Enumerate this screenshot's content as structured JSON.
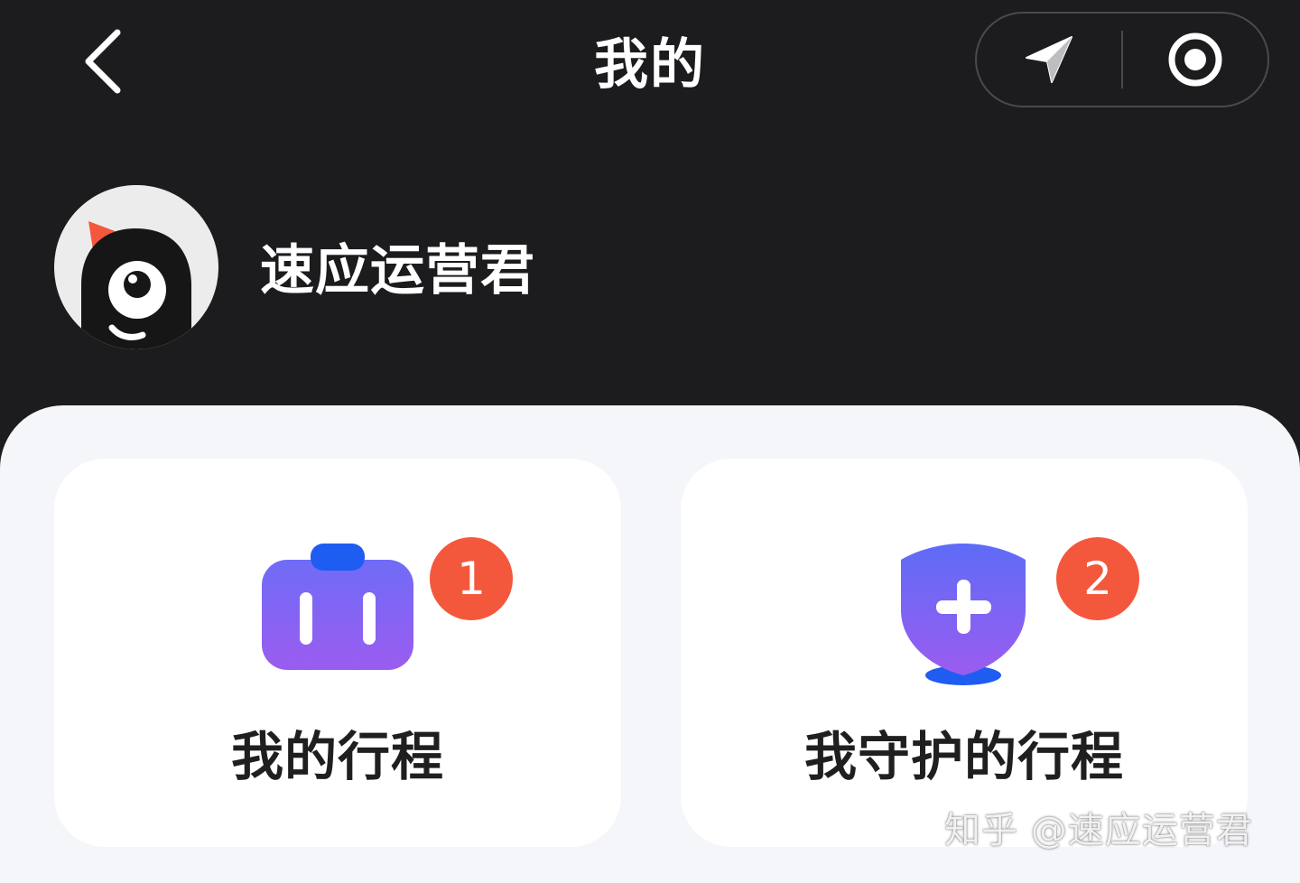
{
  "header": {
    "title": "我的",
    "back_icon": "chevron-left-icon",
    "capsule": {
      "location_icon": "navigation-arrow-icon",
      "record_icon": "target-circle-icon"
    }
  },
  "profile": {
    "avatar_icon": "mascot-avatar-icon",
    "name": "速应运营君"
  },
  "cards": [
    {
      "label": "我的行程",
      "badge": "1",
      "icon": "suitcase-icon",
      "icon_colors": [
        "#6f6cf6",
        "#8a5cf0",
        "#1f5cf2"
      ]
    },
    {
      "label": "我守护的行程",
      "badge": "2",
      "icon": "shield-plus-icon",
      "icon_colors": [
        "#5e6cf6",
        "#8a5cf0",
        "#1f5cf2"
      ]
    }
  ],
  "watermark": "知乎 @速应运营君",
  "colors": {
    "header_bg": "#1c1c1e",
    "sheet_bg": "#f5f6fa",
    "card_bg": "#ffffff",
    "badge": "#f4583c",
    "text_dark": "#1f1f1f",
    "text_light": "#ffffff"
  }
}
